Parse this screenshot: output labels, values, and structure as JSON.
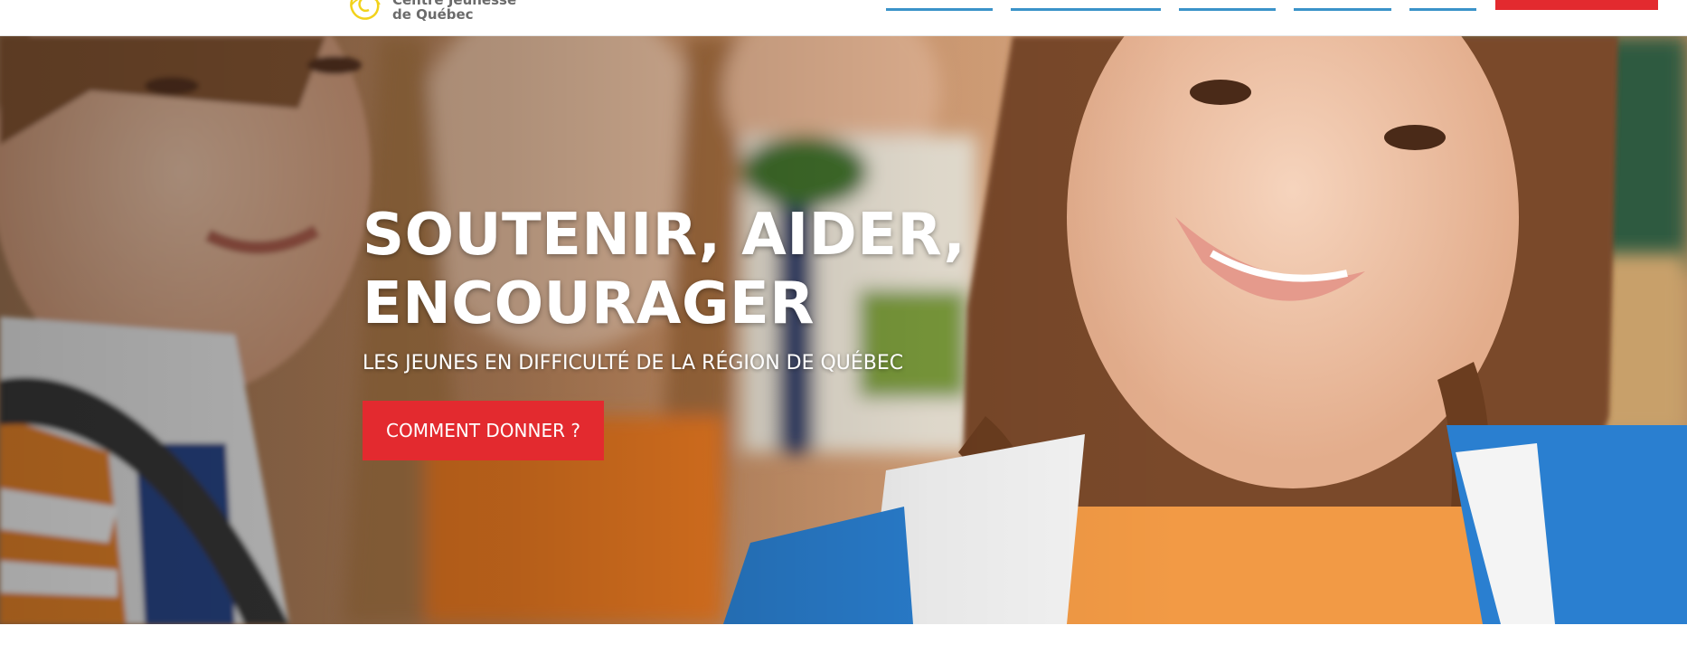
{
  "header": {
    "logo_line1": "Centre Jeunesse",
    "logo_line2": "de Québec",
    "nav_items": [
      {
        "label": ""
      },
      {
        "label": ""
      },
      {
        "label": ""
      },
      {
        "label": ""
      },
      {
        "label": ""
      }
    ],
    "cta_label": ""
  },
  "hero": {
    "title_line1": "SOUTENIR, AIDER,",
    "title_line2": "ENCOURAGER",
    "subtitle": "LES JEUNES EN DIFFICULTÉ DE LA RÉGION DE QUÉBEC",
    "button_label": "COMMENT DONNER ?",
    "background_image": "photo of smiling teenagers"
  },
  "colors": {
    "accent_red": "#e32a2f",
    "nav_blue": "#3a93c9",
    "logo_yellow": "#f2d21b",
    "logo_text": "#6b6b6b"
  },
  "icons": {
    "logo": "swirl-logo-icon"
  }
}
